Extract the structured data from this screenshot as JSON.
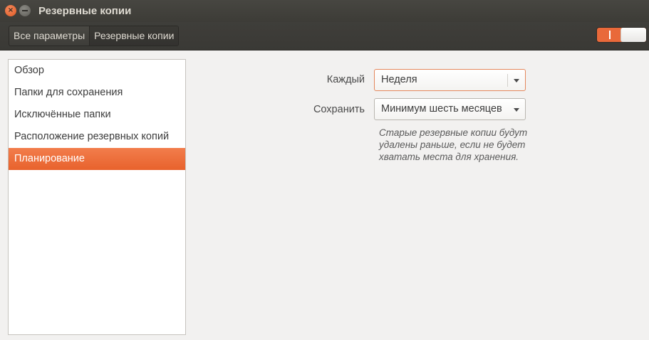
{
  "window": {
    "title": "Резервные копии"
  },
  "breadcrumb": {
    "items": [
      "Все параметры",
      "Резервные копии"
    ]
  },
  "sidebar": {
    "items": [
      {
        "label": "Обзор",
        "selected": false
      },
      {
        "label": "Папки для сохранения",
        "selected": false
      },
      {
        "label": "Исключённые папки",
        "selected": false
      },
      {
        "label": "Расположение резервных копий",
        "selected": false
      },
      {
        "label": "Планирование",
        "selected": true
      }
    ]
  },
  "schedule": {
    "every_label": "Каждый",
    "every_value": "Неделя",
    "keep_label": "Сохранить",
    "keep_value": "Минимум шесть месяцев",
    "hint": "Старые резервные копии будут удалены раньше, если не будет хватать места для хранения."
  },
  "toggle": {
    "state": "on"
  },
  "colors": {
    "accent": "#e9693a",
    "titlebar": "#3f3e3a"
  },
  "icons": {
    "close": "close-icon",
    "minimize": "minimize-icon",
    "dropdown": "chevron-down-icon"
  }
}
